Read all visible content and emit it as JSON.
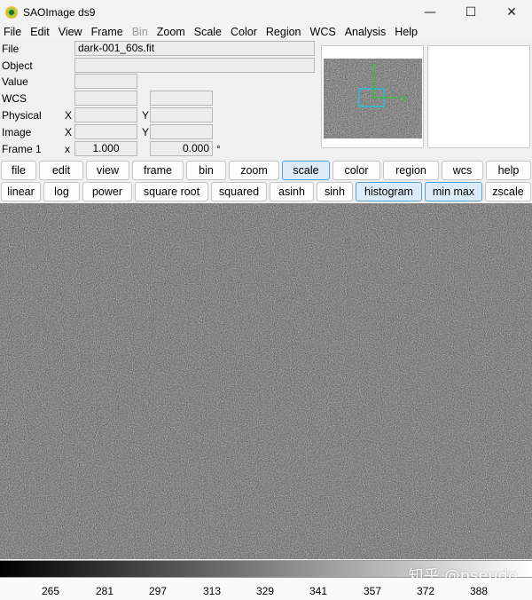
{
  "window": {
    "title": "SAOImage ds9"
  },
  "menu": [
    "File",
    "Edit",
    "View",
    "Frame",
    "Bin",
    "Zoom",
    "Scale",
    "Color",
    "Region",
    "WCS",
    "Analysis",
    "Help"
  ],
  "info": {
    "file_label": "File",
    "file_value": "dark-001_60s.fit",
    "object_label": "Object",
    "object_value": "",
    "value_label": "Value",
    "value_value": "",
    "wcs_label": "WCS",
    "wcs_value1": "",
    "wcs_value2": "",
    "physical_label": "Physical",
    "physical_x_label": "X",
    "physical_x": "",
    "physical_y_label": "Y",
    "physical_y": "",
    "image_label": "Image",
    "image_x_label": "X",
    "image_x": "",
    "image_y_label": "Y",
    "image_y": "",
    "frame_label": "Frame 1",
    "frame_x_label": "x",
    "frame_zoom": "1.000",
    "frame_angle": "0.000",
    "frame_angle_unit": "°"
  },
  "panner": {
    "compass_n": "Y",
    "compass_e": "X"
  },
  "buttons_main": [
    "file",
    "edit",
    "view",
    "frame",
    "bin",
    "zoom",
    "scale",
    "color",
    "region",
    "wcs",
    "help"
  ],
  "buttons_scale": [
    "linear",
    "log",
    "power",
    "square root",
    "squared",
    "asinh",
    "sinh",
    "histogram",
    "min max",
    "zscale"
  ],
  "colorbar_ticks": [
    "265",
    "281",
    "297",
    "313",
    "329",
    "341",
    "357",
    "372",
    "388"
  ],
  "watermark": "知乎 @pseudo",
  "colors": {
    "accent_active": "#dcebf7",
    "accent_border": "#5a9fd6",
    "compass": "#19d419",
    "pan_box": "#1fc8e0"
  }
}
